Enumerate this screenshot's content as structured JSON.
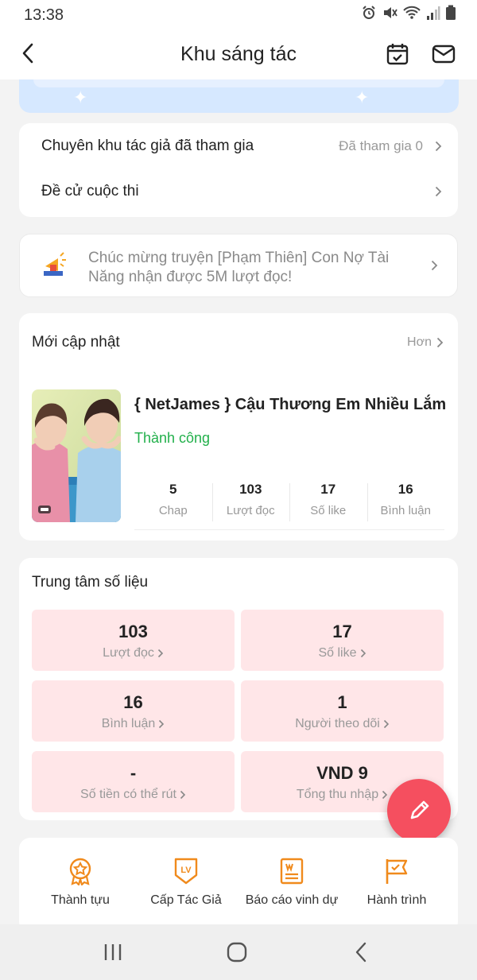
{
  "status_bar": {
    "time": "13:38"
  },
  "header": {
    "title": "Khu sáng tác"
  },
  "links": {
    "joined_zone": {
      "label": "Chuyên khu tác giả đã tham gia",
      "value": "Đã tham gia 0"
    },
    "contest": {
      "label": "Đề cử cuộc thi"
    }
  },
  "notice": {
    "text": "Chúc mừng truyện [Phạm Thiên] Con Nợ Tài Năng nhận được 5M lượt đọc!"
  },
  "recent": {
    "title": "Mới cập nhật",
    "more_label": "Hơn",
    "book": {
      "title": "{ NetJames } Cậu Thương Em Nhiều Lắm",
      "status": "Thành công",
      "stats": [
        {
          "value": "5",
          "label": "Chap"
        },
        {
          "value": "103",
          "label": "Lượt đọc"
        },
        {
          "value": "17",
          "label": "Số like"
        },
        {
          "value": "16",
          "label": "Bình luận"
        }
      ]
    }
  },
  "data_center": {
    "title": "Trung tâm số liệu",
    "tiles": [
      {
        "value": "103",
        "label": "Lượt đọc"
      },
      {
        "value": "17",
        "label": "Số like"
      },
      {
        "value": "16",
        "label": "Bình luận"
      },
      {
        "value": "1",
        "label": "Người theo dõi"
      },
      {
        "value": "-",
        "label": "Số tiền có thể rút"
      },
      {
        "value": "VND 9",
        "label": "Tổng thu nhập"
      }
    ]
  },
  "menu": [
    {
      "label": "Thành tựu",
      "icon": "medal-icon"
    },
    {
      "label": "Cấp Tác Giả",
      "icon": "level-badge-icon"
    },
    {
      "label": "Báo cáo vinh dự",
      "icon": "honor-report-icon"
    },
    {
      "label": "Hành trình",
      "icon": "journey-flag-icon"
    }
  ],
  "colors": {
    "accent": "#f54f5f",
    "tile_bg": "#ffe6e8",
    "success": "#22b04b",
    "icon_orange": "#f08a1c",
    "banner": "#d6e8ff"
  }
}
